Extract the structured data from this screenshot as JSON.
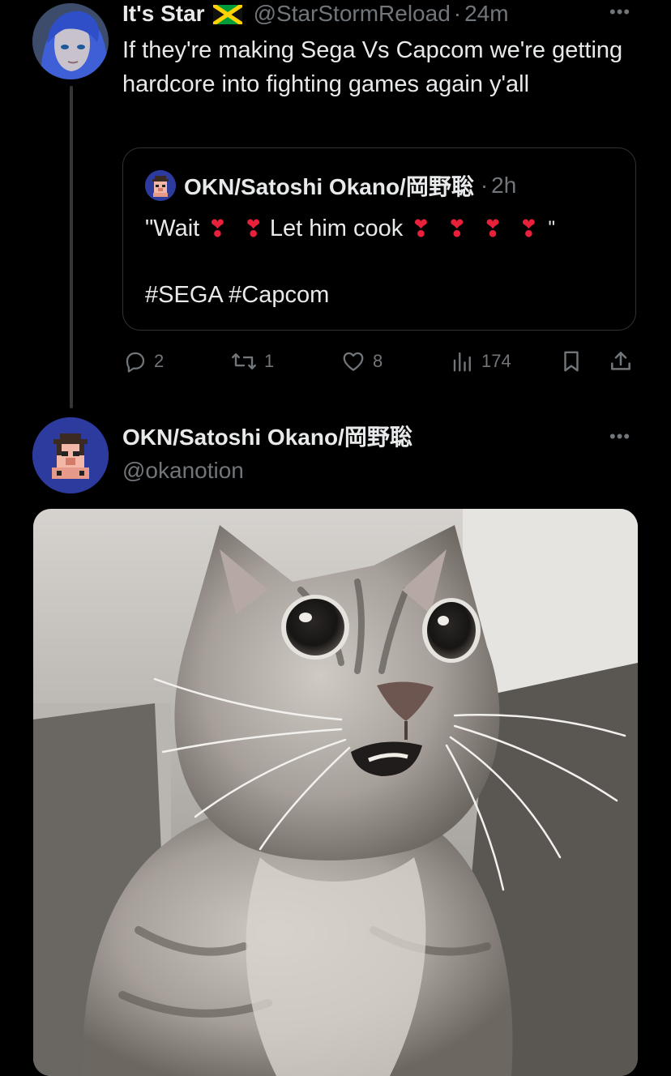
{
  "post": {
    "author_name": "It's Star",
    "flag_icon": "jamaica-flag-icon",
    "handle": "@StarStormReload",
    "separator": "·",
    "time": "24m",
    "text": "If they're making Sega Vs Capcom we're getting hardcore into fighting games again y'all",
    "more_label": "•••"
  },
  "quote": {
    "author_name": "OKN/Satoshi Okano/岡野聡",
    "separator": "·",
    "time": "2h",
    "text_wait": "\"Wait",
    "heart_glyph": "❣",
    "text_cook": "Let him cook",
    "text_quote_end": "\"",
    "hashtags": "#SEGA #Capcom"
  },
  "actions": {
    "replies": "2",
    "reposts": "1",
    "likes": "8",
    "views": "174"
  },
  "next_post": {
    "author_name": "OKN/Satoshi Okano/岡野聡",
    "handle": "@okanotion",
    "more_label": "•••"
  },
  "colors": {
    "background": "#000000",
    "text_primary": "#e7e9ea",
    "text_muted": "#71767b",
    "border": "#2f3336",
    "heart": "#e8203a",
    "okn_avatar_bg": "#2d3a9e"
  }
}
